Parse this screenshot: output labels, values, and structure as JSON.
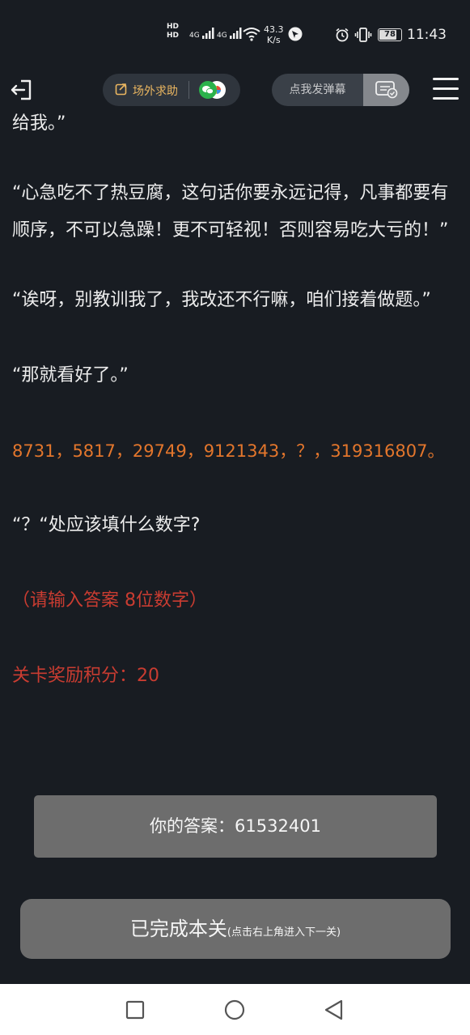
{
  "status_bar": {
    "hd1": "HD",
    "hd2": "HD",
    "net1": "4G",
    "net2": "4G",
    "speed_value": "43.3",
    "speed_unit": "K/s",
    "battery": "78",
    "time": "11:43"
  },
  "topbar": {
    "help_label": "场外求助",
    "danmu_placeholder": "点我发弹幕"
  },
  "story": {
    "lines": [
      "给我。”",
      "“心急吃不了热豆腐，这句话你要永远记得，凡事都要有顺序，不可以急躁！更不可轻视！否则容易吃大亏的！”",
      "“诶呀，别教训我了，我改还不行嘛，咱们接着做题。”",
      "“那就看好了。”",
      "8731，5817，29749，9121343，？，319316807。",
      "“？“处应该填什么数字?",
      "（请输入答案 8位数字）",
      "关卡奖励积分：20"
    ]
  },
  "answer": {
    "label": "你的答案：61532401"
  },
  "done_button": {
    "main": "已完成本关",
    "sub": "(点击右上角进入下一关)"
  },
  "colors": {
    "background": "#181c22",
    "puzzle": "#e3762c",
    "hint": "#c93c31",
    "button": "#6d6d6d"
  }
}
